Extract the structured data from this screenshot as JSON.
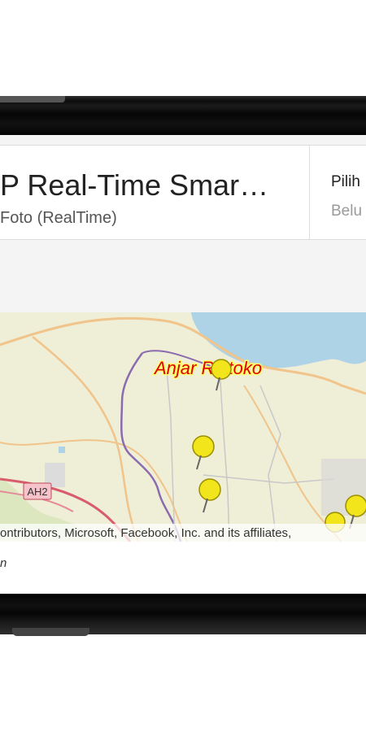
{
  "app": {
    "title": "P Real-Time Smar…",
    "subtitle": "Foto (RealTime)",
    "choose_label": "Pilih",
    "status_label": "Belu"
  },
  "map": {
    "place_label": "Anjar Riptoko",
    "road_label": "AH2",
    "attribution": "ontributors, Microsoft, Facebook, Inc. and its affiliates,",
    "caption_fragment": "n"
  },
  "colors": {
    "land": "#efeed6",
    "water": "#aed3e6",
    "road_orange": "#f0c48a",
    "road_red": "#d85c6c",
    "boundary": "#8b6bb0",
    "pin": "#f2e51b"
  }
}
